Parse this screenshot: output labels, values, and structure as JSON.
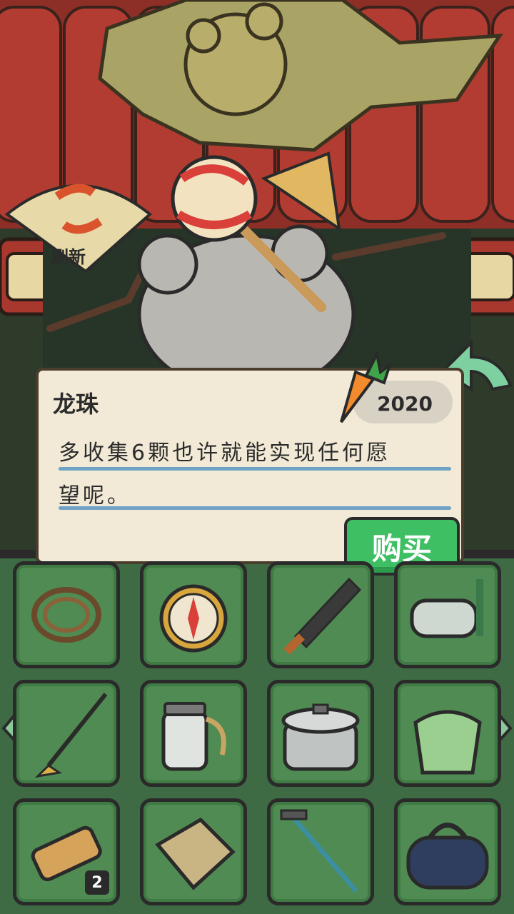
{
  "shop": {
    "refresh_label": "刷新",
    "selected_item": {
      "name": "龙珠",
      "price": "2020",
      "description_line1": "多收集6颗也许就能实现任何愿",
      "description_line2": "望呢。"
    },
    "buy_label": "购买"
  },
  "inventory": {
    "items": [
      {
        "icon": "rope-icon"
      },
      {
        "icon": "compass-icon"
      },
      {
        "icon": "machete-icon"
      },
      {
        "icon": "snorkel-mask-icon"
      },
      {
        "icon": "hiking-pole-icon"
      },
      {
        "icon": "jar-icon"
      },
      {
        "icon": "pot-icon"
      },
      {
        "icon": "green-bag-icon"
      },
      {
        "icon": "bread-icon",
        "count": "2"
      },
      {
        "icon": "tarp-icon"
      },
      {
        "icon": "trekking-stick-icon"
      },
      {
        "icon": "duffel-bag-icon"
      }
    ]
  },
  "colors": {
    "roof_red": "#a8372e",
    "panel_bg": "#f2ead6",
    "buy_green": "#3fbf63",
    "grid_green": "#4f8b52",
    "line_blue": "#6fa3c6",
    "carrot_orange": "#f28a2e"
  }
}
